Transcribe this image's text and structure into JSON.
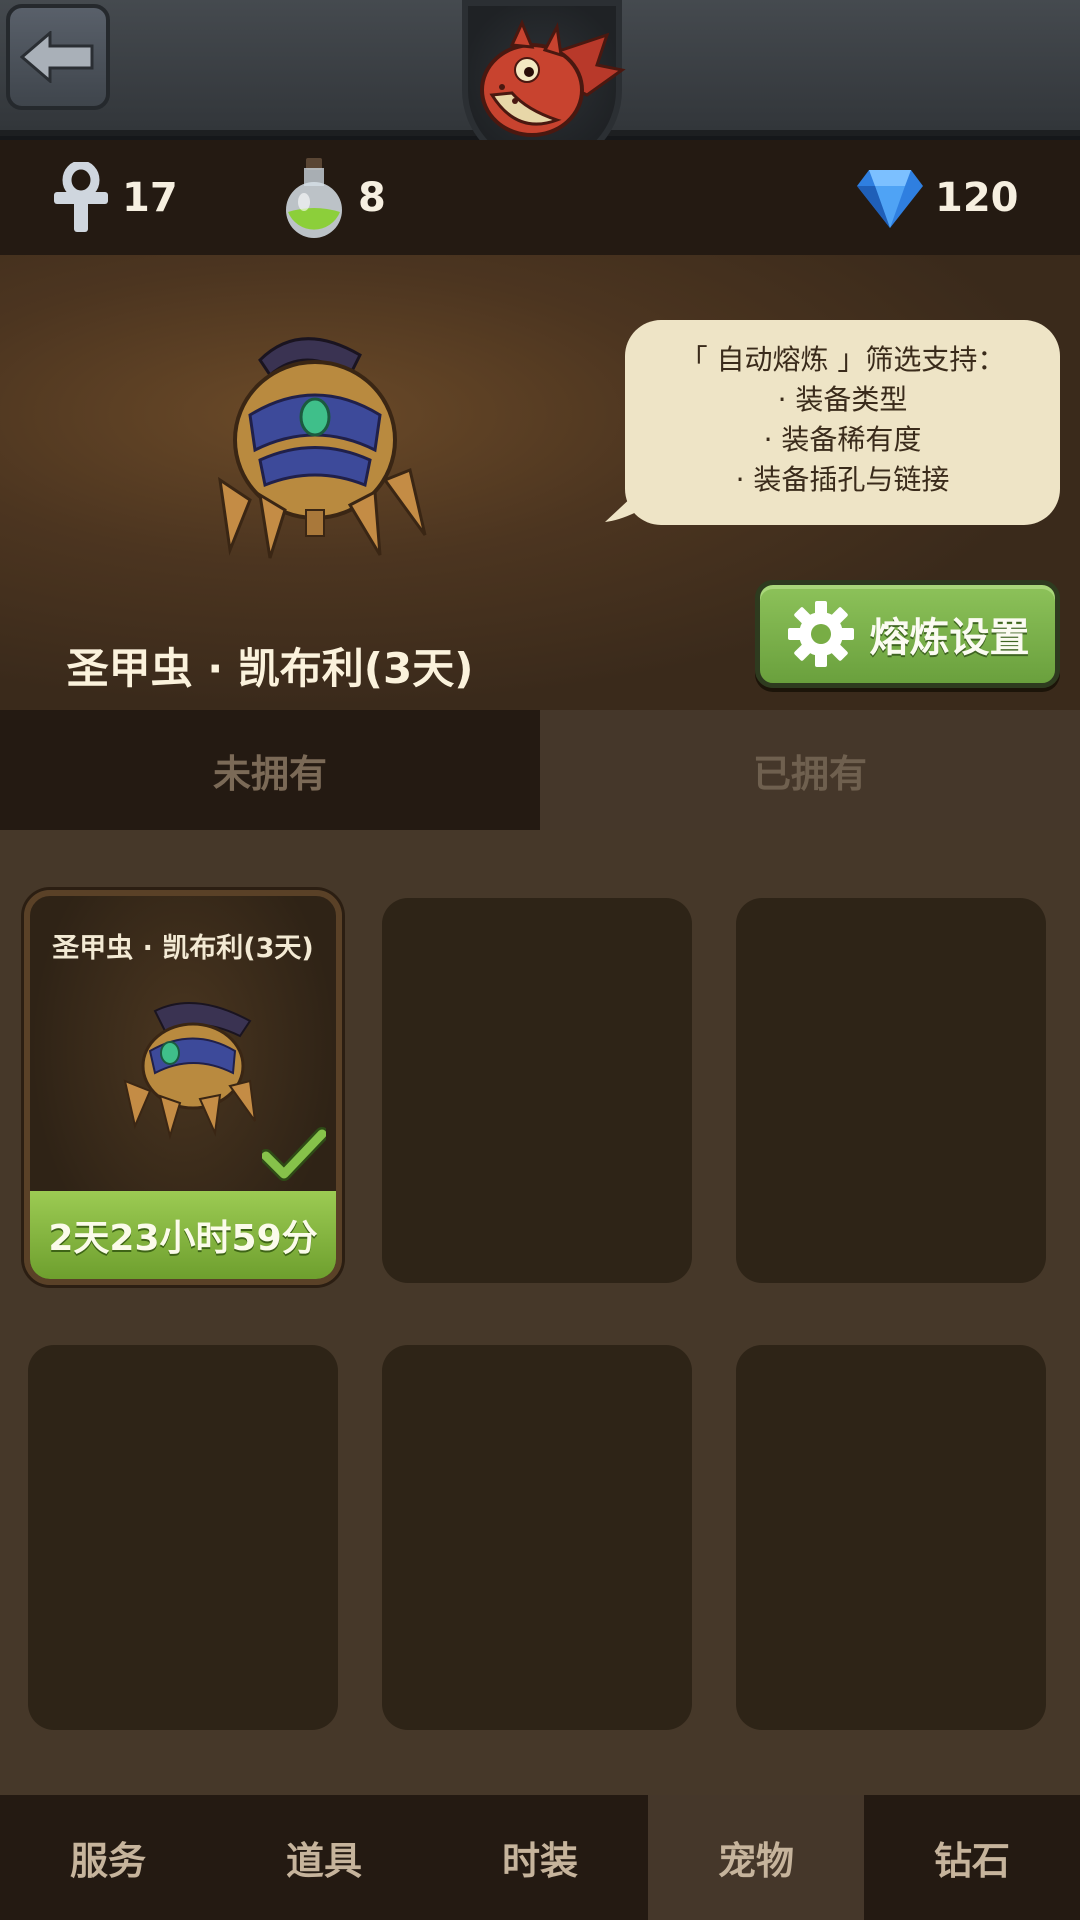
{
  "top_bar": {
    "back_icon": "arrow-left-icon",
    "emblem_icon": "red-dragon-emblem"
  },
  "resources": {
    "ankh": {
      "icon": "ankh-icon",
      "value": "17"
    },
    "potion": {
      "icon": "potion-icon",
      "value": "8"
    },
    "diamond": {
      "icon": "diamond-icon",
      "value": "120"
    }
  },
  "hero": {
    "pet_name": "圣甲虫 · 凯布利(3天)",
    "bubble_lines": [
      "「 自动熔炼 」筛选支持：",
      "· 装备类型",
      "· 装备稀有度",
      "· 装备插孔与链接"
    ],
    "smelt_button": "熔炼设置"
  },
  "tabs": [
    "未拥有",
    "已拥有"
  ],
  "grid": {
    "owned_card": {
      "title": "圣甲虫 · 凯布利(3天)",
      "timer": "2天23小时59分",
      "selected": true
    }
  },
  "nav": [
    "服务",
    "道具",
    "时装",
    "宠物",
    "钻石"
  ],
  "colors": {
    "accent_green": "#7fb445",
    "diamond_blue": "#3b8de6",
    "active_nav": "#45372a"
  }
}
